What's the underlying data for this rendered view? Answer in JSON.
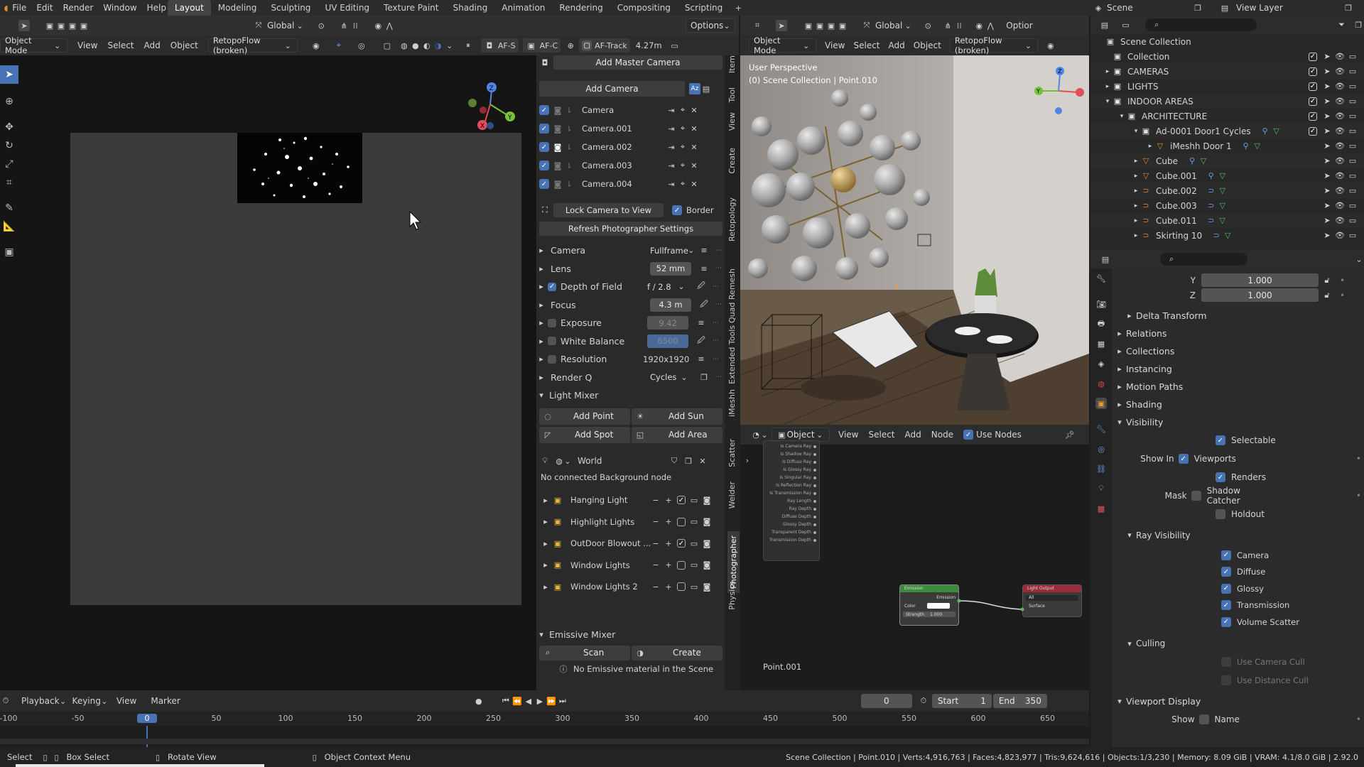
{
  "menubar": {
    "items": [
      "File",
      "Edit",
      "Render",
      "Window",
      "Help"
    ],
    "workspaces": [
      "Layout",
      "Modeling",
      "Sculpting",
      "UV Editing",
      "Texture Paint",
      "Shading",
      "Animation",
      "Rendering",
      "Compositing",
      "Scripting"
    ],
    "active_workspace": "Layout",
    "scene_label": "Scene",
    "view_layer_label": "View Layer"
  },
  "left_view": {
    "header": {
      "mode": "Object Mode",
      "menus": [
        "View",
        "Select",
        "Add",
        "Object"
      ],
      "retopo": "RetopoFlow (broken)",
      "transform": "Global",
      "options": "Options",
      "af_s": "AF-S",
      "af_c": "AF-C",
      "af_track": "AF-Track",
      "distance": "4.27m"
    }
  },
  "photographer": {
    "add_master_camera": "Add Master Camera",
    "add_camera": "Add Camera",
    "cameras": [
      {
        "name": "Camera",
        "active": false
      },
      {
        "name": "Camera.001",
        "active": false
      },
      {
        "name": "Camera.002",
        "active": true
      },
      {
        "name": "Camera.003",
        "active": false
      },
      {
        "name": "Camera.004",
        "active": false
      }
    ],
    "lock_camera": "Lock Camera to View",
    "border_label": "Border",
    "refresh": "Refresh Photographer Settings",
    "settings": [
      {
        "label": "Camera",
        "value": "Fullframe",
        "kind": "dropdown",
        "checkbox": false
      },
      {
        "label": "Lens",
        "value": "52 mm",
        "kind": "field",
        "checkbox": false
      },
      {
        "label": "Depth of Field",
        "value": "f / 2.8",
        "kind": "dropdown",
        "checkbox": true,
        "checked": true
      },
      {
        "label": "Focus",
        "value": "4.3 m",
        "kind": "field",
        "checkbox": false
      },
      {
        "label": "Exposure",
        "value": "9.42",
        "kind": "field",
        "checkbox": true,
        "checked": false
      },
      {
        "label": "White Balance",
        "value": "6500",
        "kind": "field-blue",
        "checkbox": true,
        "checked": false
      },
      {
        "label": "Resolution",
        "value": "1920x1920",
        "kind": "text",
        "checkbox": true,
        "checked": false
      },
      {
        "label": "Render Q",
        "value": "Cycles",
        "kind": "dropdown",
        "checkbox": false
      }
    ],
    "light_mixer_title": "Light Mixer",
    "add_point": "Add Point",
    "add_sun": "Add Sun",
    "add_spot": "Add Spot",
    "add_area": "Add Area",
    "world_name": "World",
    "world_note": "No connected Background node",
    "light_collections": [
      {
        "name": "Hanging Light",
        "checked": true
      },
      {
        "name": "Highlight Lights",
        "checked": false
      },
      {
        "name": "OutDoor Blowout ...",
        "checked": true
      },
      {
        "name": "Window Lights",
        "checked": false
      },
      {
        "name": "Window Lights 2",
        "checked": false
      }
    ],
    "emissive_title": "Emissive Mixer",
    "scan": "Scan",
    "create": "Create",
    "emissive_note": "No Emissive material in the Scene"
  },
  "side_tabs": [
    "Item",
    "Tool",
    "View",
    "Create",
    "Retopology",
    "Quad Remesh",
    "Extended Tools",
    "iMeshh",
    "Scatter",
    "Welder",
    "Photographer",
    "Physics"
  ],
  "right_view": {
    "header": {
      "mode": "Object Mode",
      "menus": [
        "View",
        "Select",
        "Add",
        "Object"
      ],
      "retopo": "RetopoFlow (broken)",
      "transform": "Global",
      "options": "Optior"
    },
    "perspective": "User Perspective",
    "context": "(0) Scene Collection | Point.010"
  },
  "node_editor": {
    "header": {
      "object": "Object",
      "menus": [
        "View",
        "Select",
        "Add",
        "Node"
      ],
      "use_nodes": "Use Nodes"
    },
    "light_path_outputs": [
      "Is Camera Ray",
      "Is Shadow Ray",
      "Is Diffuse Ray",
      "Is Glossy Ray",
      "Is Singular Ray",
      "Is Reflection Ray",
      "Is Transmission Ray",
      "Ray Length",
      "Ray Depth",
      "Diffuse Depth",
      "Glossy Depth",
      "Transparent Depth",
      "Transmission Depth"
    ],
    "emission_title": "Emission",
    "emission_out": "Emission",
    "emission_color": "Color",
    "emission_strength": "Strength",
    "emission_strength_value": "1.000",
    "light_output_title": "Light Output",
    "light_output_target": "All",
    "light_output_socket": "Surface",
    "object_label": "Point.001"
  },
  "outliner": {
    "root": "Scene Collection",
    "rows": [
      {
        "name": "Collection",
        "depth": 0,
        "expand": "",
        "kind": "collection"
      },
      {
        "name": "CAMERAS",
        "depth": 0,
        "expand": "▸",
        "kind": "collection"
      },
      {
        "name": "LIGHTS",
        "depth": 0,
        "expand": "▸",
        "kind": "collection"
      },
      {
        "name": "INDOOR AREAS",
        "depth": 0,
        "expand": "▾",
        "kind": "collection"
      },
      {
        "name": "ARCHITECTURE",
        "depth": 1,
        "expand": "▾",
        "kind": "collection"
      },
      {
        "name": "Ad-0001 Door1 Cycles",
        "depth": 2,
        "expand": "▾",
        "kind": "collection"
      },
      {
        "name": "iMeshh Door 1",
        "depth": 3,
        "expand": "▸",
        "kind": "mesh"
      },
      {
        "name": "Cube",
        "depth": 2,
        "expand": "▸",
        "kind": "mesh"
      },
      {
        "name": "Cube.001",
        "depth": 2,
        "expand": "▸",
        "kind": "mesh"
      },
      {
        "name": "Cube.002",
        "depth": 2,
        "expand": "▸",
        "kind": "curve"
      },
      {
        "name": "Cube.003",
        "depth": 2,
        "expand": "▸",
        "kind": "curve"
      },
      {
        "name": "Cube.011",
        "depth": 2,
        "expand": "▸",
        "kind": "curve"
      },
      {
        "name": "Skirting 10",
        "depth": 2,
        "expand": "▸",
        "kind": "curve"
      }
    ]
  },
  "properties": {
    "scale_y_label": "Y",
    "scale_y": "1.000",
    "scale_z_label": "Z",
    "scale_z": "1.000",
    "delta_transform": "Delta Transform",
    "sections": [
      "Relations",
      "Collections",
      "Instancing",
      "Motion Paths",
      "Shading"
    ],
    "visibility": "Visibility",
    "selectable": "Selectable",
    "show_in": "Show In",
    "viewports": "Viewports",
    "renders": "Renders",
    "mask": "Mask",
    "shadow_catcher": "Shadow Catcher",
    "holdout": "Holdout",
    "ray_visibility": "Ray Visibility",
    "rays": [
      "Camera",
      "Diffuse",
      "Glossy",
      "Transmission",
      "Volume Scatter"
    ],
    "culling": "Culling",
    "use_camera_cull": "Use Camera Cull",
    "use_distance_cull": "Use Distance Cull",
    "viewport_display": "Viewport Display",
    "show": "Show",
    "name": "Name"
  },
  "timeline": {
    "menus": [
      "Playback",
      "Keying",
      "View",
      "Marker"
    ],
    "current_frame": "0",
    "start_label": "Start",
    "start": "1",
    "end_label": "End",
    "end": "350",
    "ticks": [
      "-100",
      "-50",
      "0",
      "50",
      "100",
      "150",
      "200",
      "250",
      "300",
      "350",
      "400",
      "450",
      "500",
      "550",
      "600",
      "650"
    ]
  },
  "statusbar": {
    "select": "Select",
    "box_select": "Box Select",
    "rotate_view": "Rotate View",
    "context_menu": "Object Context Menu",
    "stats": "Scene Collection | Point.010 | Verts:4,916,763 | Faces:4,823,977 | Tris:9,624,616 | Objects:1/3,230 | Memory: 8.09 GiB | VRAM: 4.1/8.0 GiB | 2.92.0"
  },
  "colors": {
    "accent": "#4772b3",
    "collection_yellow": "#e8b83c",
    "mesh_orange": "#e28b32",
    "curve_green": "#58b868"
  }
}
